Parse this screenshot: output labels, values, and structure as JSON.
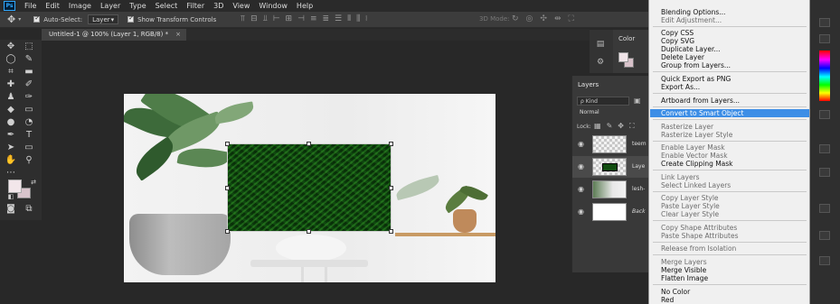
{
  "menubar": {
    "logo": "Ps",
    "items": [
      "File",
      "Edit",
      "Image",
      "Layer",
      "Type",
      "Select",
      "Filter",
      "3D",
      "View",
      "Window",
      "Help"
    ]
  },
  "options": {
    "auto_select_label": "Auto-Select:",
    "auto_select_value": "Layer",
    "transform_label": "Show Transform Controls",
    "mode_3d_label": "3D Mode:"
  },
  "document": {
    "tab_label": "Untitled-1 @ 100% (Layer 1, RGB/8) *",
    "close": "×"
  },
  "color_panel": {
    "title": "Color"
  },
  "layers_panel": {
    "title": "Layers",
    "kind_label": "ρ Kind",
    "blend_mode": "Normal",
    "lock_label": "Lock:",
    "layers": [
      {
        "name": "teem",
        "type": "transparent"
      },
      {
        "name": "Laye",
        "type": "fern"
      },
      {
        "name": "lesh-",
        "type": "photo"
      },
      {
        "name": "Back",
        "type": "white"
      }
    ]
  },
  "context_menu": {
    "items": [
      {
        "label": "Blending Options...",
        "disabled": false
      },
      {
        "label": "Edit Adjustment...",
        "disabled": true
      },
      {
        "label": "Copy CSS",
        "disabled": false
      },
      {
        "label": "Copy SVG",
        "disabled": false
      },
      {
        "label": "Duplicate Layer...",
        "disabled": false
      },
      {
        "label": "Delete Layer",
        "disabled": false
      },
      {
        "label": "Group from Layers...",
        "disabled": false
      },
      {
        "label": "Quick Export as PNG",
        "disabled": false
      },
      {
        "label": "Export As...",
        "disabled": false
      },
      {
        "label": "Artboard from Layers...",
        "disabled": false
      },
      {
        "label": "Convert to Smart Object",
        "disabled": false,
        "highlighted": true
      },
      {
        "label": "Rasterize Layer",
        "disabled": true
      },
      {
        "label": "Rasterize Layer Style",
        "disabled": true
      },
      {
        "label": "Enable Layer Mask",
        "disabled": true
      },
      {
        "label": "Enable Vector Mask",
        "disabled": true
      },
      {
        "label": "Create Clipping Mask",
        "disabled": false
      },
      {
        "label": "Link Layers",
        "disabled": true
      },
      {
        "label": "Select Linked Layers",
        "disabled": true
      },
      {
        "label": "Copy Layer Style",
        "disabled": true
      },
      {
        "label": "Paste Layer Style",
        "disabled": true
      },
      {
        "label": "Clear Layer Style",
        "disabled": true
      },
      {
        "label": "Copy Shape Attributes",
        "disabled": true
      },
      {
        "label": "Paste Shape Attributes",
        "disabled": true
      },
      {
        "label": "Release from Isolation",
        "disabled": true
      },
      {
        "label": "Merge Layers",
        "disabled": true
      },
      {
        "label": "Merge Visible",
        "disabled": false
      },
      {
        "label": "Flatten Image",
        "disabled": false
      },
      {
        "label": "No Color",
        "disabled": false
      },
      {
        "label": "Red",
        "disabled": false
      }
    ]
  },
  "colors": {
    "highlight": "#3d8ee6",
    "foreground_swatch": "#f2e6ea",
    "background_swatch": "#d9c4cc"
  }
}
